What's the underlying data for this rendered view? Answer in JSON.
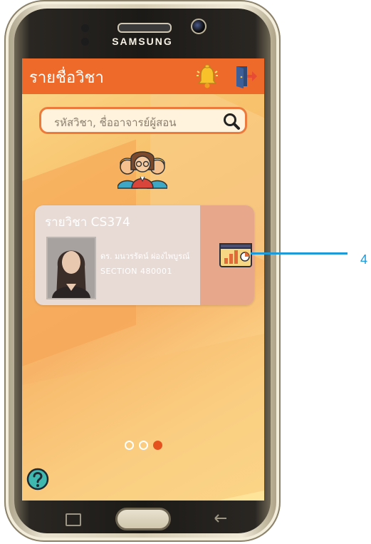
{
  "device": {
    "brand": "SAMSUNG"
  },
  "appbar": {
    "title": "รายชื่อวิชา"
  },
  "search": {
    "placeholder": "รหัสวิชา, ชื่ออาจารย์ผู้สอน"
  },
  "course": {
    "title": "รายวิชา CS374",
    "teacher": "ดร. มนวรรัตน์ ผ่องไพบูรณ์",
    "section": "SECTION 480001"
  },
  "pagination": {
    "total": 3,
    "active": 3
  },
  "annotation": {
    "number": "4"
  },
  "colors": {
    "appbar": "#ee6a2b",
    "card_accent": "#e6a78a",
    "active_dot": "#e6521f",
    "callout": "#1f9ad8"
  },
  "icons": [
    "bell-icon",
    "logout-icon",
    "search-icon",
    "students-group-icon",
    "stats-chart-icon",
    "help-icon"
  ]
}
